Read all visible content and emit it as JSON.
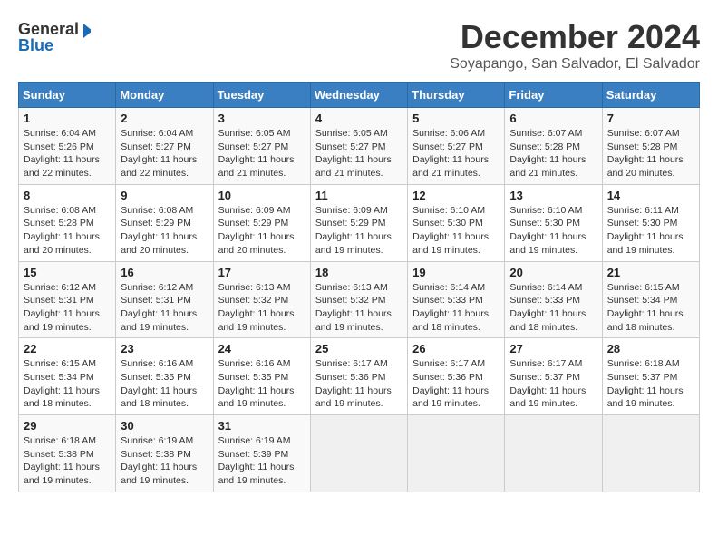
{
  "header": {
    "logo_line1": "General",
    "logo_line2": "Blue",
    "month": "December 2024",
    "location": "Soyapango, San Salvador, El Salvador"
  },
  "weekdays": [
    "Sunday",
    "Monday",
    "Tuesday",
    "Wednesday",
    "Thursday",
    "Friday",
    "Saturday"
  ],
  "weeks": [
    [
      {
        "day": "1",
        "info": "Sunrise: 6:04 AM\nSunset: 5:26 PM\nDaylight: 11 hours\nand 22 minutes."
      },
      {
        "day": "2",
        "info": "Sunrise: 6:04 AM\nSunset: 5:27 PM\nDaylight: 11 hours\nand 22 minutes."
      },
      {
        "day": "3",
        "info": "Sunrise: 6:05 AM\nSunset: 5:27 PM\nDaylight: 11 hours\nand 21 minutes."
      },
      {
        "day": "4",
        "info": "Sunrise: 6:05 AM\nSunset: 5:27 PM\nDaylight: 11 hours\nand 21 minutes."
      },
      {
        "day": "5",
        "info": "Sunrise: 6:06 AM\nSunset: 5:27 PM\nDaylight: 11 hours\nand 21 minutes."
      },
      {
        "day": "6",
        "info": "Sunrise: 6:07 AM\nSunset: 5:28 PM\nDaylight: 11 hours\nand 21 minutes."
      },
      {
        "day": "7",
        "info": "Sunrise: 6:07 AM\nSunset: 5:28 PM\nDaylight: 11 hours\nand 20 minutes."
      }
    ],
    [
      {
        "day": "8",
        "info": "Sunrise: 6:08 AM\nSunset: 5:28 PM\nDaylight: 11 hours\nand 20 minutes."
      },
      {
        "day": "9",
        "info": "Sunrise: 6:08 AM\nSunset: 5:29 PM\nDaylight: 11 hours\nand 20 minutes."
      },
      {
        "day": "10",
        "info": "Sunrise: 6:09 AM\nSunset: 5:29 PM\nDaylight: 11 hours\nand 20 minutes."
      },
      {
        "day": "11",
        "info": "Sunrise: 6:09 AM\nSunset: 5:29 PM\nDaylight: 11 hours\nand 19 minutes."
      },
      {
        "day": "12",
        "info": "Sunrise: 6:10 AM\nSunset: 5:30 PM\nDaylight: 11 hours\nand 19 minutes."
      },
      {
        "day": "13",
        "info": "Sunrise: 6:10 AM\nSunset: 5:30 PM\nDaylight: 11 hours\nand 19 minutes."
      },
      {
        "day": "14",
        "info": "Sunrise: 6:11 AM\nSunset: 5:30 PM\nDaylight: 11 hours\nand 19 minutes."
      }
    ],
    [
      {
        "day": "15",
        "info": "Sunrise: 6:12 AM\nSunset: 5:31 PM\nDaylight: 11 hours\nand 19 minutes."
      },
      {
        "day": "16",
        "info": "Sunrise: 6:12 AM\nSunset: 5:31 PM\nDaylight: 11 hours\nand 19 minutes."
      },
      {
        "day": "17",
        "info": "Sunrise: 6:13 AM\nSunset: 5:32 PM\nDaylight: 11 hours\nand 19 minutes."
      },
      {
        "day": "18",
        "info": "Sunrise: 6:13 AM\nSunset: 5:32 PM\nDaylight: 11 hours\nand 19 minutes."
      },
      {
        "day": "19",
        "info": "Sunrise: 6:14 AM\nSunset: 5:33 PM\nDaylight: 11 hours\nand 18 minutes."
      },
      {
        "day": "20",
        "info": "Sunrise: 6:14 AM\nSunset: 5:33 PM\nDaylight: 11 hours\nand 18 minutes."
      },
      {
        "day": "21",
        "info": "Sunrise: 6:15 AM\nSunset: 5:34 PM\nDaylight: 11 hours\nand 18 minutes."
      }
    ],
    [
      {
        "day": "22",
        "info": "Sunrise: 6:15 AM\nSunset: 5:34 PM\nDaylight: 11 hours\nand 18 minutes."
      },
      {
        "day": "23",
        "info": "Sunrise: 6:16 AM\nSunset: 5:35 PM\nDaylight: 11 hours\nand 18 minutes."
      },
      {
        "day": "24",
        "info": "Sunrise: 6:16 AM\nSunset: 5:35 PM\nDaylight: 11 hours\nand 19 minutes."
      },
      {
        "day": "25",
        "info": "Sunrise: 6:17 AM\nSunset: 5:36 PM\nDaylight: 11 hours\nand 19 minutes."
      },
      {
        "day": "26",
        "info": "Sunrise: 6:17 AM\nSunset: 5:36 PM\nDaylight: 11 hours\nand 19 minutes."
      },
      {
        "day": "27",
        "info": "Sunrise: 6:17 AM\nSunset: 5:37 PM\nDaylight: 11 hours\nand 19 minutes."
      },
      {
        "day": "28",
        "info": "Sunrise: 6:18 AM\nSunset: 5:37 PM\nDaylight: 11 hours\nand 19 minutes."
      }
    ],
    [
      {
        "day": "29",
        "info": "Sunrise: 6:18 AM\nSunset: 5:38 PM\nDaylight: 11 hours\nand 19 minutes."
      },
      {
        "day": "30",
        "info": "Sunrise: 6:19 AM\nSunset: 5:38 PM\nDaylight: 11 hours\nand 19 minutes."
      },
      {
        "day": "31",
        "info": "Sunrise: 6:19 AM\nSunset: 5:39 PM\nDaylight: 11 hours\nand 19 minutes."
      },
      {
        "day": "",
        "info": ""
      },
      {
        "day": "",
        "info": ""
      },
      {
        "day": "",
        "info": ""
      },
      {
        "day": "",
        "info": ""
      }
    ]
  ]
}
